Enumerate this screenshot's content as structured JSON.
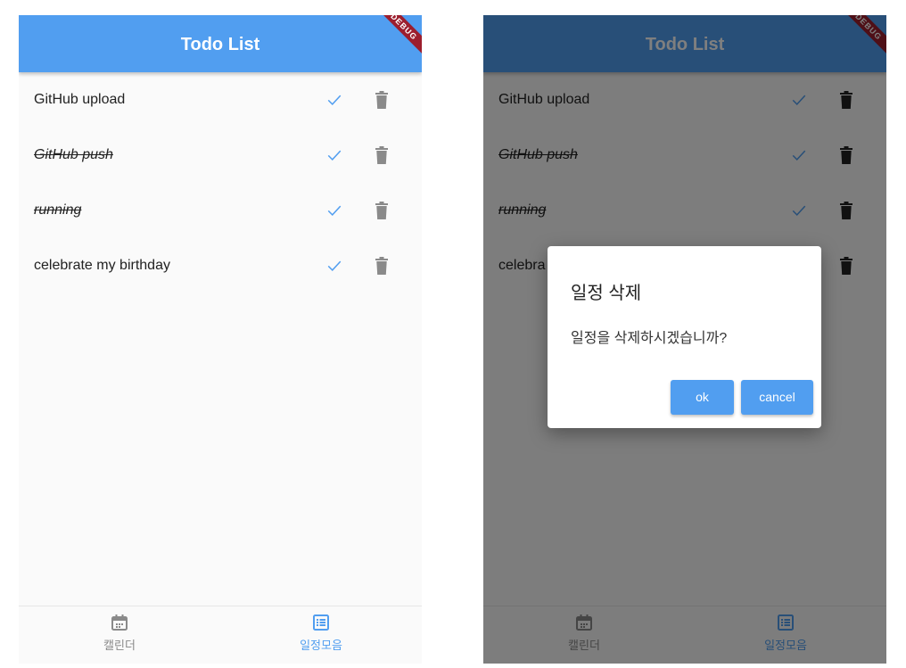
{
  "app": {
    "title": "Todo List",
    "debug_banner": "DEBUG"
  },
  "todos": [
    {
      "text": "GitHub upload",
      "done": false
    },
    {
      "text": "GitHub push",
      "done": true
    },
    {
      "text": "running",
      "done": true
    },
    {
      "text": "celebrate my birthday",
      "done": false
    }
  ],
  "todos_right_truncated_last": "celebra",
  "nav": {
    "calendar_label": "캘린더",
    "schedule_label": "일정모음",
    "active": "schedule"
  },
  "dialog": {
    "title": "일정 삭제",
    "message": "일정을 삭제하시겠습니까?",
    "ok_label": "ok",
    "cancel_label": "cancel"
  },
  "colors": {
    "primary": "#519ef0",
    "banner": "#9c1e2e",
    "trash": "#8a8a8a"
  },
  "icons": {
    "done": "check-icon",
    "delete": "trash-icon",
    "calendar": "calendar-icon",
    "schedule": "list-icon"
  }
}
